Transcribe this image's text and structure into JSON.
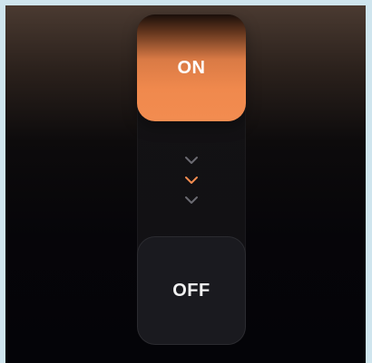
{
  "toggle": {
    "on_label": "ON",
    "off_label": "OFF",
    "state": "on"
  },
  "icons": {
    "chevron_top": "chevron-down-icon",
    "chevron_middle": "chevron-down-icon",
    "chevron_bottom": "chevron-down-icon"
  },
  "colors": {
    "accent": "#F28C50",
    "chevron_inactive": "#6B6B72",
    "chevron_active": "#F28C50",
    "off_surface": "#1A1A1F"
  }
}
